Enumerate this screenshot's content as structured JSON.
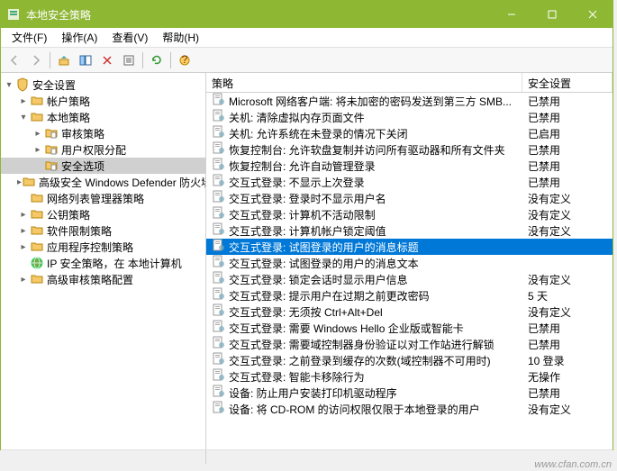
{
  "window": {
    "title": "本地安全策略"
  },
  "menu": {
    "file": "文件(F)",
    "action": "操作(A)",
    "view": "查看(V)",
    "help": "帮助(H)"
  },
  "tree": [
    {
      "label": "安全设置",
      "indent": 0,
      "icon": "shield",
      "toggle": "▾"
    },
    {
      "label": "帐户策略",
      "indent": 1,
      "icon": "folder",
      "toggle": "▸"
    },
    {
      "label": "本地策略",
      "indent": 1,
      "icon": "folder",
      "toggle": "▾"
    },
    {
      "label": "审核策略",
      "indent": 2,
      "icon": "folder-doc",
      "toggle": "▸"
    },
    {
      "label": "用户权限分配",
      "indent": 2,
      "icon": "folder-doc",
      "toggle": "▸"
    },
    {
      "label": "安全选项",
      "indent": 2,
      "icon": "folder-doc",
      "toggle": "",
      "selected": true
    },
    {
      "label": "高级安全 Windows Defender 防火墙",
      "indent": 1,
      "icon": "folder",
      "toggle": "▸"
    },
    {
      "label": "网络列表管理器策略",
      "indent": 1,
      "icon": "folder",
      "toggle": ""
    },
    {
      "label": "公钥策略",
      "indent": 1,
      "icon": "folder",
      "toggle": "▸"
    },
    {
      "label": "软件限制策略",
      "indent": 1,
      "icon": "folder",
      "toggle": "▸"
    },
    {
      "label": "应用程序控制策略",
      "indent": 1,
      "icon": "folder",
      "toggle": "▸"
    },
    {
      "label": "IP 安全策略，在 本地计算机",
      "indent": 1,
      "icon": "globe",
      "toggle": ""
    },
    {
      "label": "高级审核策略配置",
      "indent": 1,
      "icon": "folder",
      "toggle": "▸"
    }
  ],
  "list": {
    "col_policy": "策略",
    "col_setting": "安全设置",
    "rows": [
      {
        "policy": "Microsoft 网络客户端: 将未加密的密码发送到第三方 SMB...",
        "setting": "已禁用"
      },
      {
        "policy": "关机: 清除虚拟内存页面文件",
        "setting": "已禁用"
      },
      {
        "policy": "关机: 允许系统在未登录的情况下关闭",
        "setting": "已启用"
      },
      {
        "policy": "恢复控制台: 允许软盘复制并访问所有驱动器和所有文件夹",
        "setting": "已禁用"
      },
      {
        "policy": "恢复控制台: 允许自动管理登录",
        "setting": "已禁用"
      },
      {
        "policy": "交互式登录: 不显示上次登录",
        "setting": "已禁用"
      },
      {
        "policy": "交互式登录: 登录时不显示用户名",
        "setting": "没有定义"
      },
      {
        "policy": "交互式登录: 计算机不活动限制",
        "setting": "没有定义"
      },
      {
        "policy": "交互式登录: 计算机帐户锁定阈值",
        "setting": "没有定义"
      },
      {
        "policy": "交互式登录: 试图登录的用户的消息标题",
        "setting": "",
        "selected": true
      },
      {
        "policy": "交互式登录: 试图登录的用户的消息文本",
        "setting": ""
      },
      {
        "policy": "交互式登录: 锁定会话时显示用户信息",
        "setting": "没有定义"
      },
      {
        "policy": "交互式登录: 提示用户在过期之前更改密码",
        "setting": "5 天"
      },
      {
        "policy": "交互式登录: 无须按 Ctrl+Alt+Del",
        "setting": "没有定义"
      },
      {
        "policy": "交互式登录: 需要 Windows Hello 企业版或智能卡",
        "setting": "已禁用"
      },
      {
        "policy": "交互式登录: 需要域控制器身份验证以对工作站进行解锁",
        "setting": "已禁用"
      },
      {
        "policy": "交互式登录: 之前登录到缓存的次数(域控制器不可用时)",
        "setting": "10 登录"
      },
      {
        "policy": "交互式登录: 智能卡移除行为",
        "setting": "无操作"
      },
      {
        "policy": "设备: 防止用户安装打印机驱动程序",
        "setting": "已禁用"
      },
      {
        "policy": "设备: 将 CD-ROM 的访问权限仅限于本地登录的用户",
        "setting": "没有定义"
      }
    ]
  },
  "watermark": "www.cfan.com.cn"
}
